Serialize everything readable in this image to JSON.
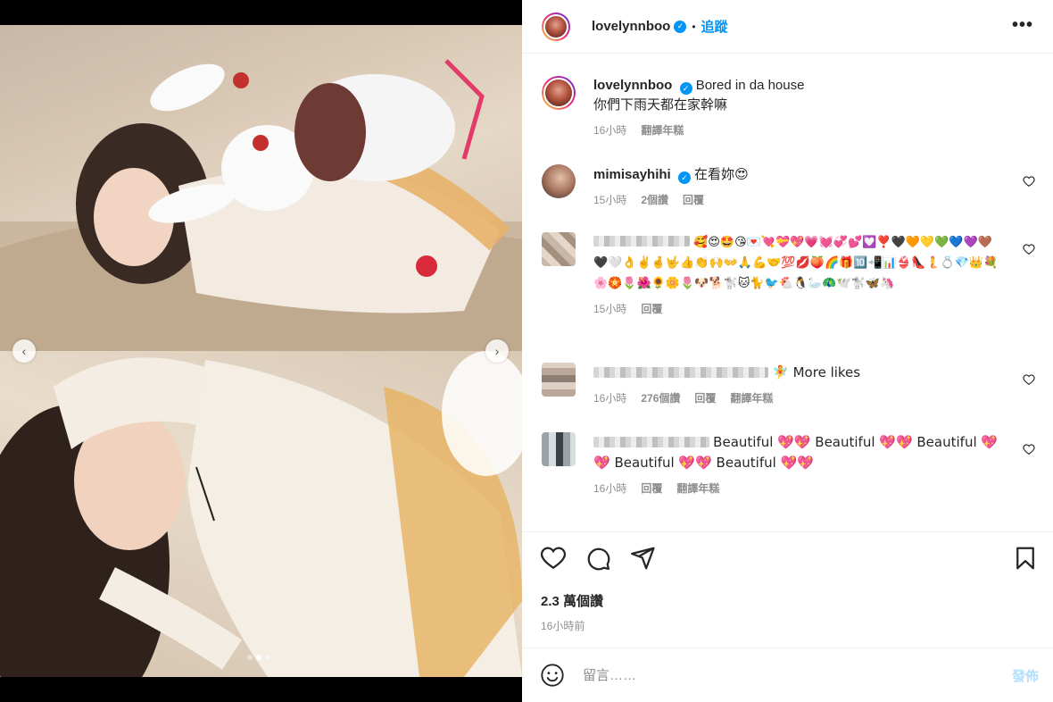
{
  "post": {
    "username": "lovelynnboo",
    "follow_label": "追蹤",
    "separator": "•",
    "more_label": "•••",
    "caption_title": "Bored in da house",
    "caption_line2": "你們下雨天都在家幹嘛",
    "caption_time": "16小時",
    "caption_translate": "翻譯年糕",
    "likes": "2.3 萬個讚",
    "posted_time": "16小時前"
  },
  "comments": [
    {
      "username": "mimisayhihi",
      "text": "在看妳",
      "emoji": "😍",
      "time": "15小時",
      "likes": "2個讚",
      "reply": "回覆"
    },
    {
      "username": "",
      "text": "🥰😍🤩😘💌💘💝💖💗💓💞💕💟❣️🖤🧡💛💚💙💜🤎🖤🤍👌✌️🤞🤟👍👏🙌👐🙏💪🤝💯💋🍑🌈🎁🔟📲📊👙👠🧜💍💎👑💐🌸🏵️🌷🌺🌻🌼🌷🐶🐕🐩🐱🐈🐦🐔🐧🦢🦚🕊️🐩🦋🦄",
      "time": "15小時",
      "reply": "回覆"
    },
    {
      "username": "",
      "text": "🧚 More likes",
      "time": "16小時",
      "likes": "276個讚",
      "reply": "回覆",
      "translate": "翻譯年糕"
    },
    {
      "username": "",
      "text": "Beautiful 💖💖 Beautiful 💖💖 Beautiful 💖💖 Beautiful 💖💖 Beautiful 💖💖",
      "time": "16小時",
      "reply": "回覆",
      "translate": "翻譯年糕"
    }
  ],
  "composer": {
    "placeholder": "留言……",
    "post_label": "發佈"
  },
  "carousel": {
    "prev": "‹",
    "next": "›",
    "slides": 3,
    "active_slide": 2
  },
  "colors": {
    "accent": "#0095f6",
    "verified": "#0095f6",
    "muted": "#8e8e8e"
  }
}
